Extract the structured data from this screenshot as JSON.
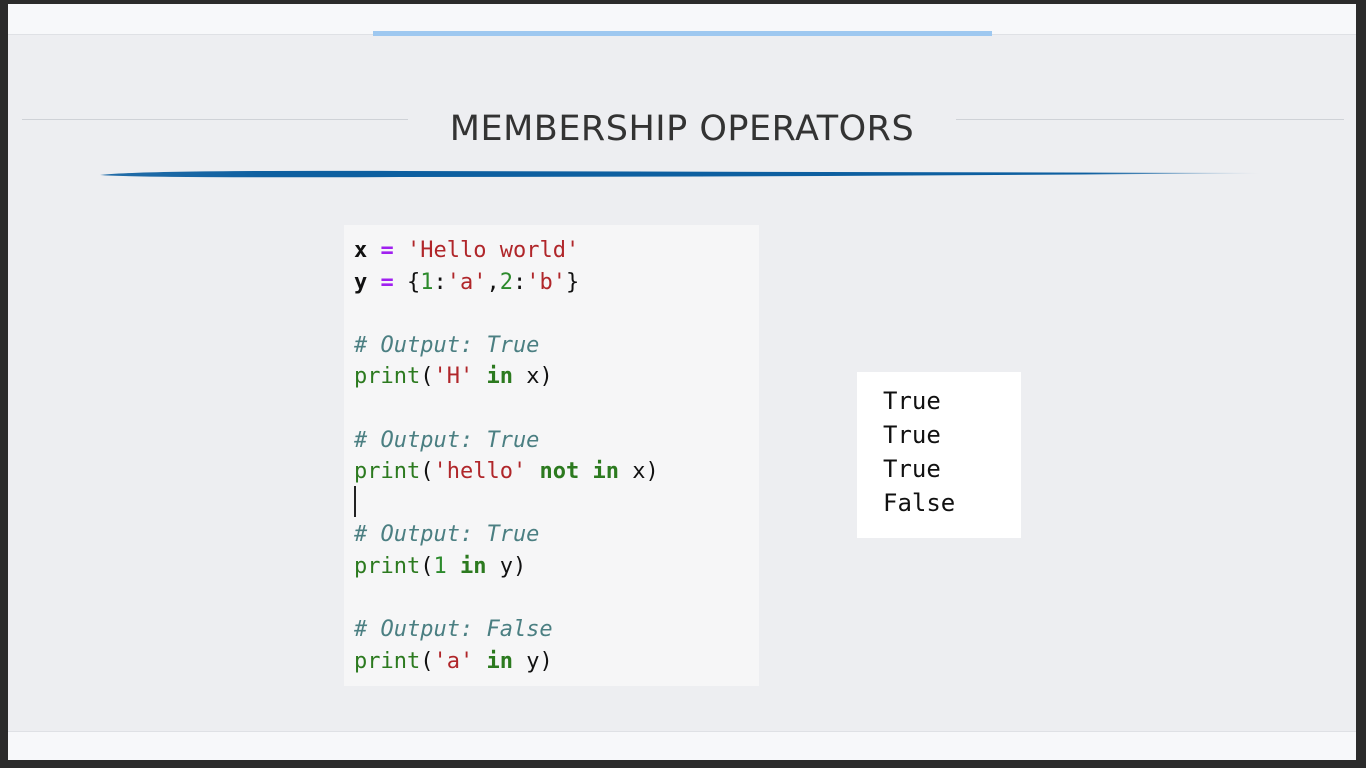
{
  "slide": {
    "title": "MEMBERSHIP OPERATORS"
  },
  "colors": {
    "background": "#edeef1",
    "top_accent": "#9ec8f0",
    "underline": "#0d5fa0",
    "keyword": "#2c7a1f",
    "string": "#b0262a",
    "comment": "#4b7f82",
    "operator": "#a020f0"
  },
  "code": {
    "lines": [
      [
        {
          "t": "x",
          "c": "var"
        },
        {
          "t": " ",
          "c": "id"
        },
        {
          "t": "=",
          "c": "op"
        },
        {
          "t": " ",
          "c": "id"
        },
        {
          "t": "'Hello world'",
          "c": "str"
        }
      ],
      [
        {
          "t": "y",
          "c": "var"
        },
        {
          "t": " ",
          "c": "id"
        },
        {
          "t": "=",
          "c": "op"
        },
        {
          "t": " {",
          "c": "id"
        },
        {
          "t": "1",
          "c": "num"
        },
        {
          "t": ":",
          "c": "id"
        },
        {
          "t": "'a'",
          "c": "str"
        },
        {
          "t": ",",
          "c": "id"
        },
        {
          "t": "2",
          "c": "num"
        },
        {
          "t": ":",
          "c": "id"
        },
        {
          "t": "'b'",
          "c": "str"
        },
        {
          "t": "}",
          "c": "id"
        }
      ],
      [],
      [
        {
          "t": "# Output: True",
          "c": "cmt"
        }
      ],
      [
        {
          "t": "print",
          "c": "fn"
        },
        {
          "t": "(",
          "c": "id"
        },
        {
          "t": "'H'",
          "c": "str"
        },
        {
          "t": " ",
          "c": "id"
        },
        {
          "t": "in",
          "c": "kw"
        },
        {
          "t": " x)",
          "c": "id"
        }
      ],
      [],
      [
        {
          "t": "# Output: True",
          "c": "cmt"
        }
      ],
      [
        {
          "t": "print",
          "c": "fn"
        },
        {
          "t": "(",
          "c": "id"
        },
        {
          "t": "'hello'",
          "c": "str"
        },
        {
          "t": " ",
          "c": "id"
        },
        {
          "t": "not",
          "c": "kw"
        },
        {
          "t": " ",
          "c": "id"
        },
        {
          "t": "in",
          "c": "kw"
        },
        {
          "t": " x)",
          "c": "id"
        }
      ],
      [],
      [
        {
          "t": "# Output: True",
          "c": "cmt"
        }
      ],
      [
        {
          "t": "print",
          "c": "fn"
        },
        {
          "t": "(",
          "c": "id"
        },
        {
          "t": "1",
          "c": "num"
        },
        {
          "t": " ",
          "c": "id"
        },
        {
          "t": "in",
          "c": "kw"
        },
        {
          "t": " y)",
          "c": "id"
        }
      ],
      [],
      [
        {
          "t": "# Output: False",
          "c": "cmt"
        }
      ],
      [
        {
          "t": "print",
          "c": "fn"
        },
        {
          "t": "(",
          "c": "id"
        },
        {
          "t": "'a'",
          "c": "str"
        },
        {
          "t": " ",
          "c": "id"
        },
        {
          "t": "in",
          "c": "kw"
        },
        {
          "t": " y)",
          "c": "id"
        }
      ]
    ]
  },
  "output": {
    "lines": [
      "True",
      "True",
      "True",
      "False"
    ]
  }
}
